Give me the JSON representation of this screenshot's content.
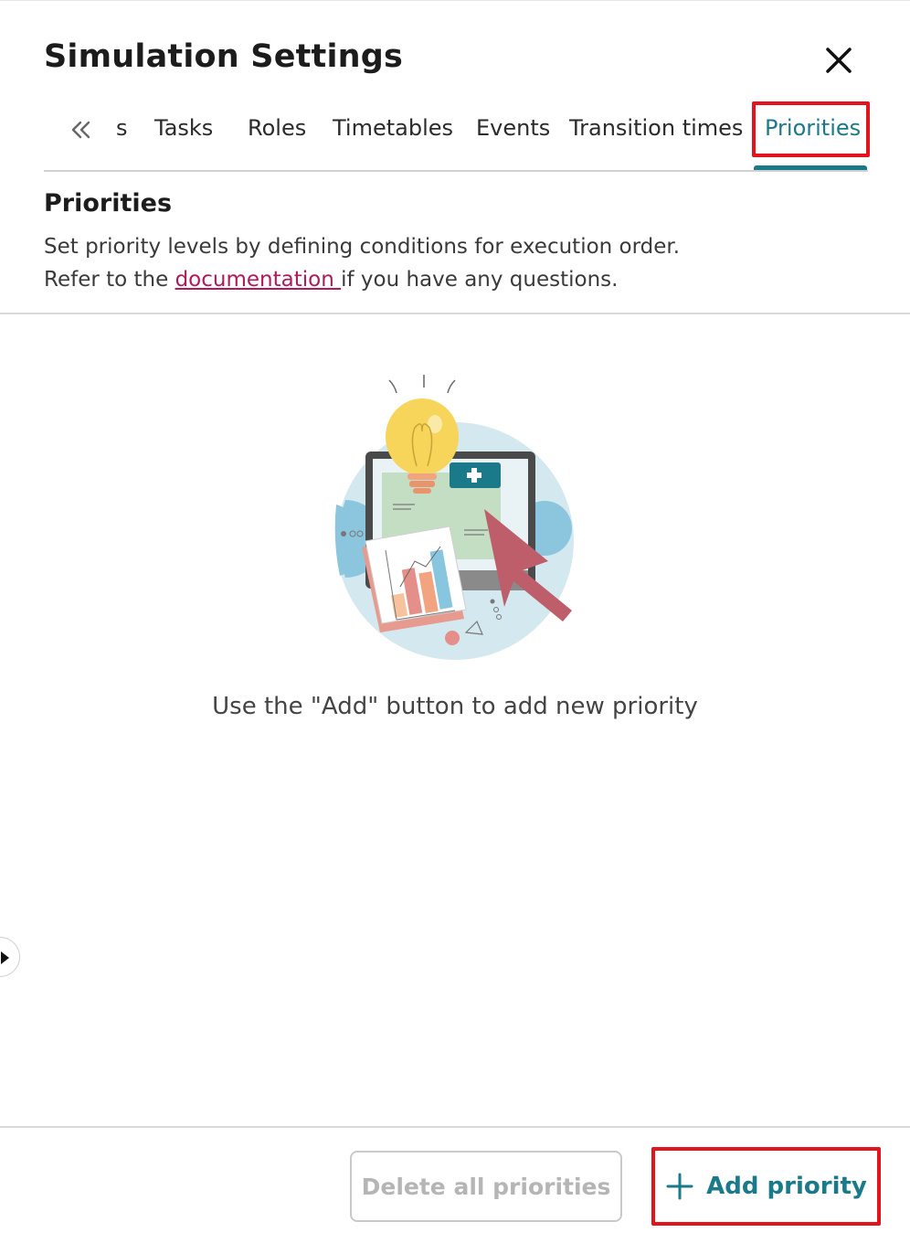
{
  "dialog": {
    "title": "Simulation Settings",
    "close_icon": "close-icon"
  },
  "tabs": {
    "scroll_icon": "double-chevron-left-icon",
    "items": [
      {
        "label": "s"
      },
      {
        "label": "Tasks"
      },
      {
        "label": "Roles"
      },
      {
        "label": "Timetables"
      },
      {
        "label": "Events"
      },
      {
        "label": "Transition times"
      },
      {
        "label": "Priorities",
        "active": true
      }
    ]
  },
  "section": {
    "title": "Priorities",
    "description_line1": "Set priority levels by defining conditions for execution order.",
    "description_prefix": "Refer to the ",
    "documentation_link": "documentation ",
    "description_suffix": "if you have any questions."
  },
  "empty_state": {
    "illustration_icon": "empty-state-illustration",
    "message": "Use the \"Add\" button to add new priority"
  },
  "side_toggle": {
    "icon": "chevron-right-icon"
  },
  "footer": {
    "delete_all_label": "Delete all priorities",
    "add_label": "Add priority",
    "add_icon": "plus-icon"
  },
  "colors": {
    "accent": "#1b7a8a",
    "link": "#b0195a",
    "highlight": "#e3141c",
    "disabled_text": "#b5b5b5"
  }
}
